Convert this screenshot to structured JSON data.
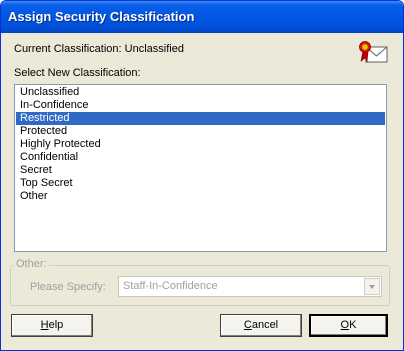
{
  "window": {
    "title": "Assign Security Classification"
  },
  "current_classification": {
    "label": "Current Classification: Unclassified"
  },
  "select_label": "Select New Classification:",
  "classifications": [
    {
      "label": "Unclassified",
      "selected": false
    },
    {
      "label": "In-Confidence",
      "selected": false
    },
    {
      "label": "Restricted",
      "selected": true
    },
    {
      "label": "Protected",
      "selected": false
    },
    {
      "label": "Highly Protected",
      "selected": false
    },
    {
      "label": "Confidential",
      "selected": false
    },
    {
      "label": "Secret",
      "selected": false
    },
    {
      "label": "Top Secret",
      "selected": false
    },
    {
      "label": "Other",
      "selected": false
    }
  ],
  "other_group": {
    "label": "Other:",
    "specify_label": "Please Specify:",
    "specify_value": "Staff-In-Confidence",
    "enabled": false
  },
  "buttons": {
    "help": {
      "mnemonic": "H",
      "rest": "elp"
    },
    "cancel": {
      "mnemonic": "C",
      "rest": "ancel"
    },
    "ok": {
      "mnemonic": "O",
      "rest": "K"
    }
  },
  "colors": {
    "title_bar": "#0058e6",
    "selection": "#316ac5",
    "dialog_background": "#ece9d8",
    "disabled_text": "#a0a0a0"
  },
  "icons": {
    "certificate": "certificate-ribbon-envelope-icon",
    "dropdown": "chevron-down-icon"
  }
}
